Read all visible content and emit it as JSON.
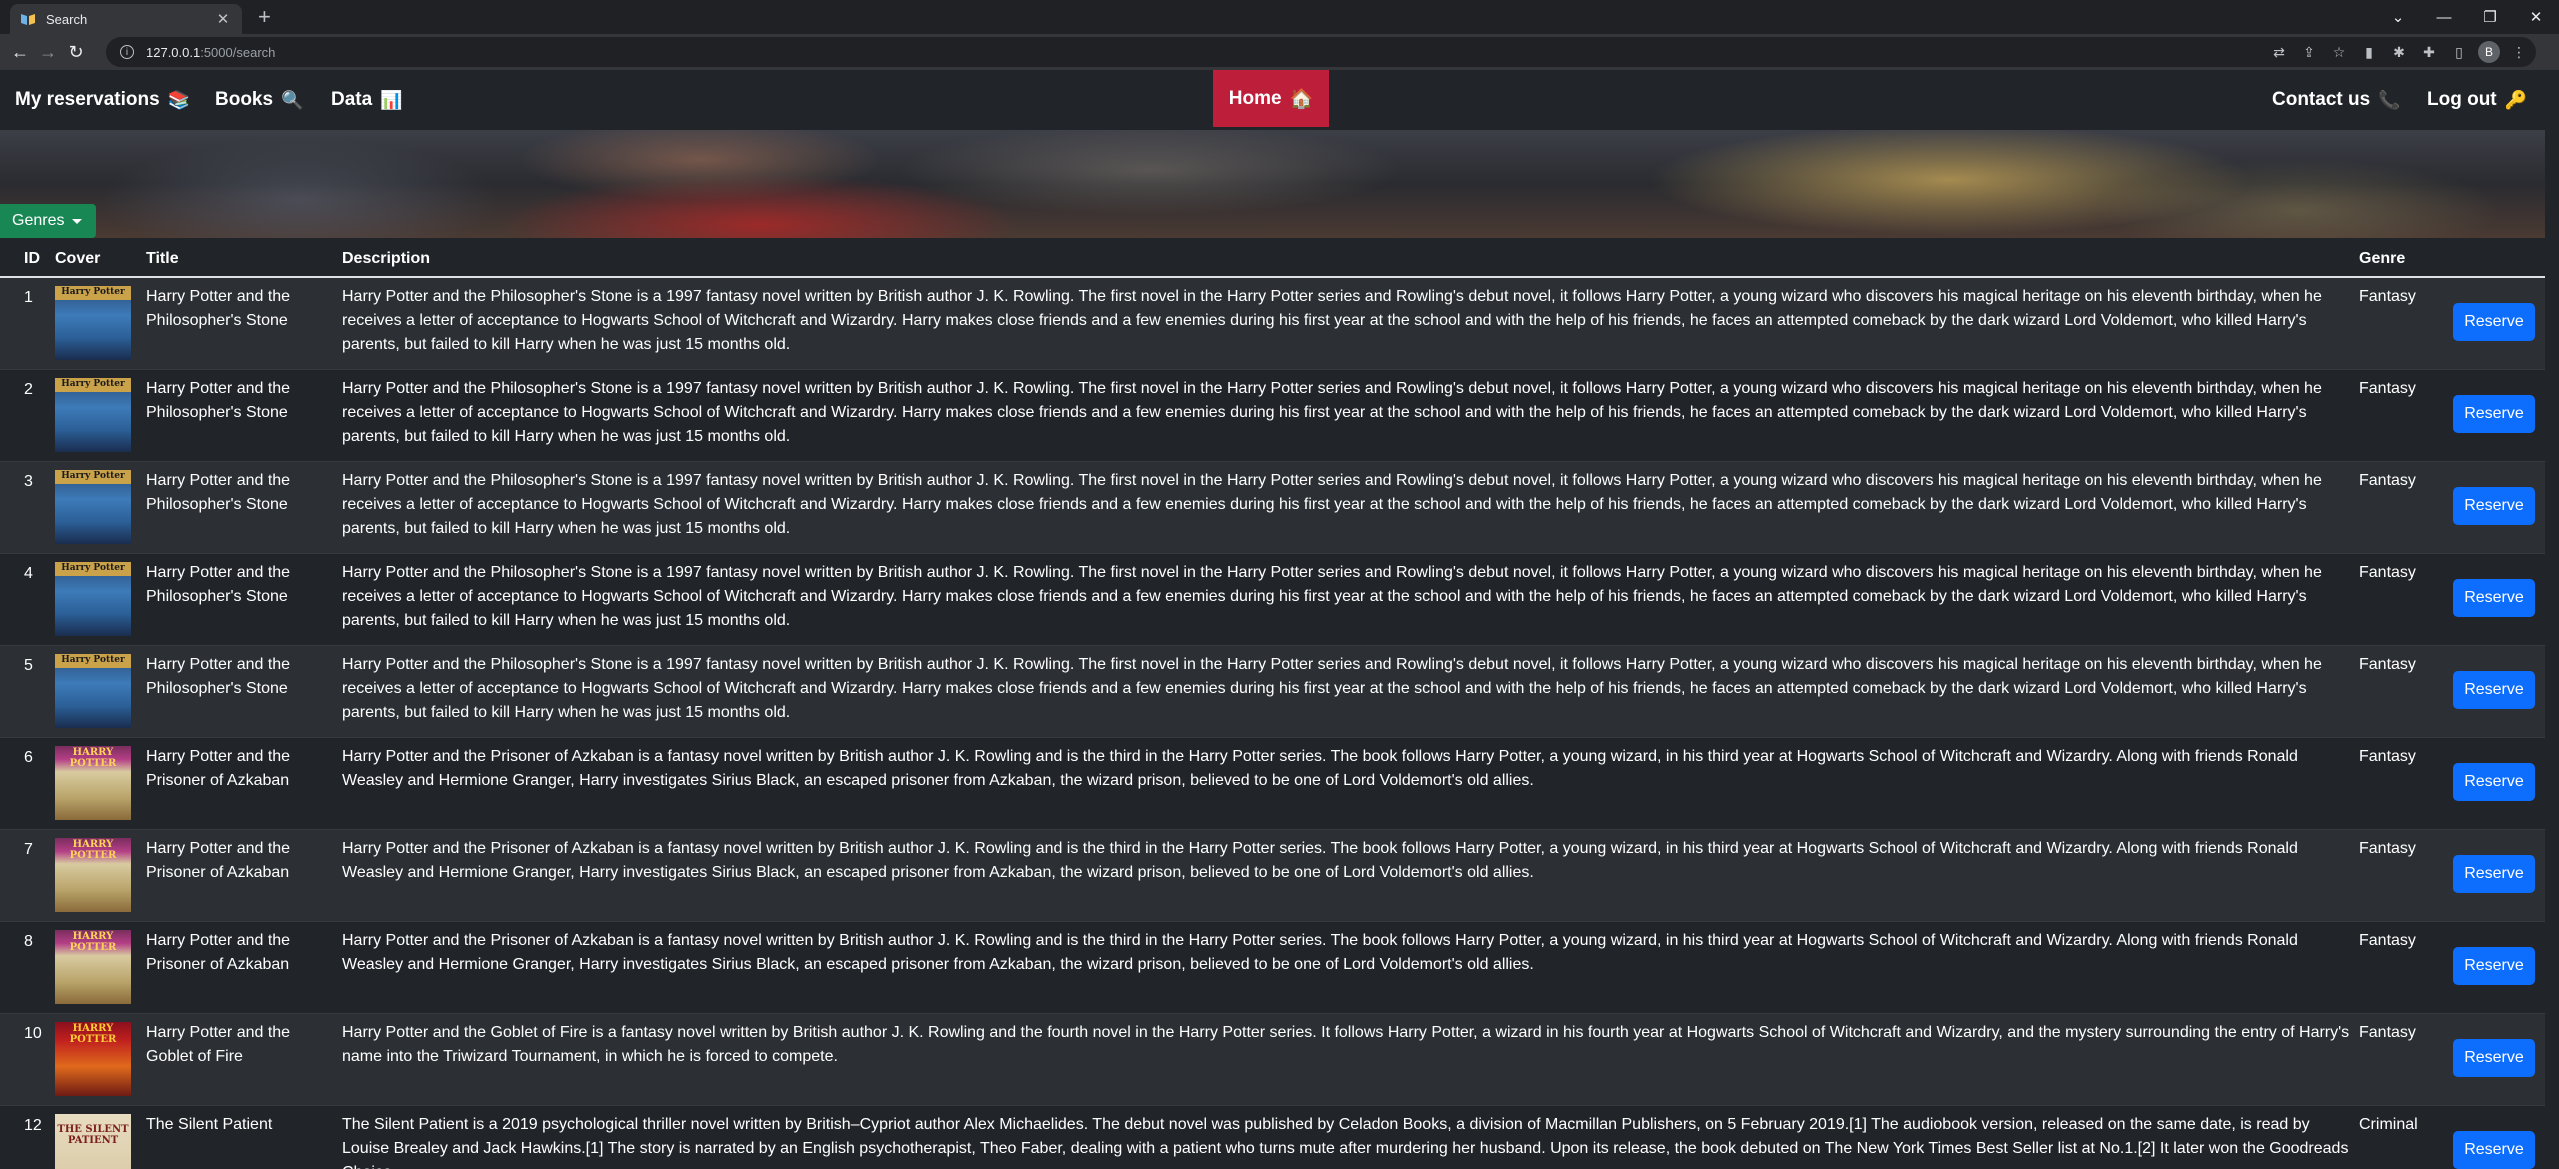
{
  "browser": {
    "tab_title": "Search",
    "tab_close": "✕",
    "new_tab": "+",
    "url_host": "127.0.0.1",
    "url_path": ":5000/search",
    "profile_initial": "B"
  },
  "nav": {
    "my_reservations": "My reservations",
    "books": "Books",
    "data": "Data",
    "home": "Home",
    "contact_us": "Contact us",
    "log_out": "Log out"
  },
  "genres_button": "Genres",
  "table": {
    "headers": {
      "id": "ID",
      "cover": "Cover",
      "title": "Title",
      "description": "Description",
      "genre": "Genre"
    },
    "reserve_label": "Reserve",
    "rows": [
      {
        "id": "1",
        "cover": "ps",
        "cover_text": "Harry Potter",
        "title": "Harry Potter and the Philosopher's Stone",
        "description": "Harry Potter and the Philosopher's Stone is a 1997 fantasy novel written by British author J. K. Rowling. The first novel in the Harry Potter series and Rowling's debut novel, it follows Harry Potter, a young wizard who discovers his magical heritage on his eleventh birthday, when he receives a letter of acceptance to Hogwarts School of Witchcraft and Wizardry. Harry makes close friends and a few enemies during his first year at the school and with the help of his friends, he faces an attempted comeback by the dark wizard Lord Voldemort, who killed Harry's parents, but failed to kill Harry when he was just 15 months old.",
        "genre": "Fantasy"
      },
      {
        "id": "2",
        "cover": "ps",
        "cover_text": "Harry Potter",
        "title": "Harry Potter and the Philosopher's Stone",
        "description": "Harry Potter and the Philosopher's Stone is a 1997 fantasy novel written by British author J. K. Rowling. The first novel in the Harry Potter series and Rowling's debut novel, it follows Harry Potter, a young wizard who discovers his magical heritage on his eleventh birthday, when he receives a letter of acceptance to Hogwarts School of Witchcraft and Wizardry. Harry makes close friends and a few enemies during his first year at the school and with the help of his friends, he faces an attempted comeback by the dark wizard Lord Voldemort, who killed Harry's parents, but failed to kill Harry when he was just 15 months old.",
        "genre": "Fantasy"
      },
      {
        "id": "3",
        "cover": "ps",
        "cover_text": "Harry Potter",
        "title": "Harry Potter and the Philosopher's Stone",
        "description": "Harry Potter and the Philosopher's Stone is a 1997 fantasy novel written by British author J. K. Rowling. The first novel in the Harry Potter series and Rowling's debut novel, it follows Harry Potter, a young wizard who discovers his magical heritage on his eleventh birthday, when he receives a letter of acceptance to Hogwarts School of Witchcraft and Wizardry. Harry makes close friends and a few enemies during his first year at the school and with the help of his friends, he faces an attempted comeback by the dark wizard Lord Voldemort, who killed Harry's parents, but failed to kill Harry when he was just 15 months old.",
        "genre": "Fantasy"
      },
      {
        "id": "4",
        "cover": "ps",
        "cover_text": "Harry Potter",
        "title": "Harry Potter and the Philosopher's Stone",
        "description": "Harry Potter and the Philosopher's Stone is a 1997 fantasy novel written by British author J. K. Rowling. The first novel in the Harry Potter series and Rowling's debut novel, it follows Harry Potter, a young wizard who discovers his magical heritage on his eleventh birthday, when he receives a letter of acceptance to Hogwarts School of Witchcraft and Wizardry. Harry makes close friends and a few enemies during his first year at the school and with the help of his friends, he faces an attempted comeback by the dark wizard Lord Voldemort, who killed Harry's parents, but failed to kill Harry when he was just 15 months old.",
        "genre": "Fantasy"
      },
      {
        "id": "5",
        "cover": "ps",
        "cover_text": "Harry Potter",
        "title": "Harry Potter and the Philosopher's Stone",
        "description": "Harry Potter and the Philosopher's Stone is a 1997 fantasy novel written by British author J. K. Rowling. The first novel in the Harry Potter series and Rowling's debut novel, it follows Harry Potter, a young wizard who discovers his magical heritage on his eleventh birthday, when he receives a letter of acceptance to Hogwarts School of Witchcraft and Wizardry. Harry makes close friends and a few enemies during his first year at the school and with the help of his friends, he faces an attempted comeback by the dark wizard Lord Voldemort, who killed Harry's parents, but failed to kill Harry when he was just 15 months old.",
        "genre": "Fantasy"
      },
      {
        "id": "6",
        "cover": "pa",
        "cover_text": "HARRY POTTER",
        "title": "Harry Potter and the Prisoner of Azkaban",
        "description": "Harry Potter and the Prisoner of Azkaban is a fantasy novel written by British author J. K. Rowling and is the third in the Harry Potter series. The book follows Harry Potter, a young wizard, in his third year at Hogwarts School of Witchcraft and Wizardry. Along with friends Ronald Weasley and Hermione Granger, Harry investigates Sirius Black, an escaped prisoner from Azkaban, the wizard prison, believed to be one of Lord Voldemort's old allies.",
        "genre": "Fantasy"
      },
      {
        "id": "7",
        "cover": "pa",
        "cover_text": "HARRY POTTER",
        "title": "Harry Potter and the Prisoner of Azkaban",
        "description": "Harry Potter and the Prisoner of Azkaban is a fantasy novel written by British author J. K. Rowling and is the third in the Harry Potter series. The book follows Harry Potter, a young wizard, in his third year at Hogwarts School of Witchcraft and Wizardry. Along with friends Ronald Weasley and Hermione Granger, Harry investigates Sirius Black, an escaped prisoner from Azkaban, the wizard prison, believed to be one of Lord Voldemort's old allies.",
        "genre": "Fantasy"
      },
      {
        "id": "8",
        "cover": "pa",
        "cover_text": "HARRY POTTER",
        "title": "Harry Potter and the Prisoner of Azkaban",
        "description": "Harry Potter and the Prisoner of Azkaban is a fantasy novel written by British author J. K. Rowling and is the third in the Harry Potter series. The book follows Harry Potter, a young wizard, in his third year at Hogwarts School of Witchcraft and Wizardry. Along with friends Ronald Weasley and Hermione Granger, Harry investigates Sirius Black, an escaped prisoner from Azkaban, the wizard prison, believed to be one of Lord Voldemort's old allies.",
        "genre": "Fantasy"
      },
      {
        "id": "10",
        "cover": "gf",
        "cover_text": "HARRY POTTER",
        "title": "Harry Potter and the Goblet of Fire",
        "description": "Harry Potter and the Goblet of Fire is a fantasy novel written by British author J. K. Rowling and the fourth novel in the Harry Potter series. It follows Harry Potter, a wizard in his fourth year at Hogwarts School of Witchcraft and Wizardry, and the mystery surrounding the entry of Harry's name into the Triwizard Tournament, in which he is forced to compete.",
        "genre": "Fantasy"
      },
      {
        "id": "12",
        "cover": "sp",
        "cover_text": "THE SILENT PATIENT",
        "title": "The Silent Patient",
        "description": "The Silent Patient is a 2019 psychological thriller novel written by British–Cypriot author Alex Michaelides. The debut novel was published by Celadon Books, a division of Macmillan Publishers, on 5 February 2019.[1] The audiobook version, released on the same date, is read by Louise Brealey and Jack Hawkins.[1] The story is narrated by an English psychotherapist, Theo Faber, dealing with a patient who turns mute after murdering her husband. Upon its release, the book debuted on The New York Times Best Seller list at No.1.[2] It later won the Goodreads Choice",
        "genre": "Criminal"
      }
    ]
  },
  "colors": {
    "home_accent": "#bd1f3a",
    "genres_button": "#198754",
    "reserve_button": "#0d6efd",
    "page_bg": "#212529"
  }
}
